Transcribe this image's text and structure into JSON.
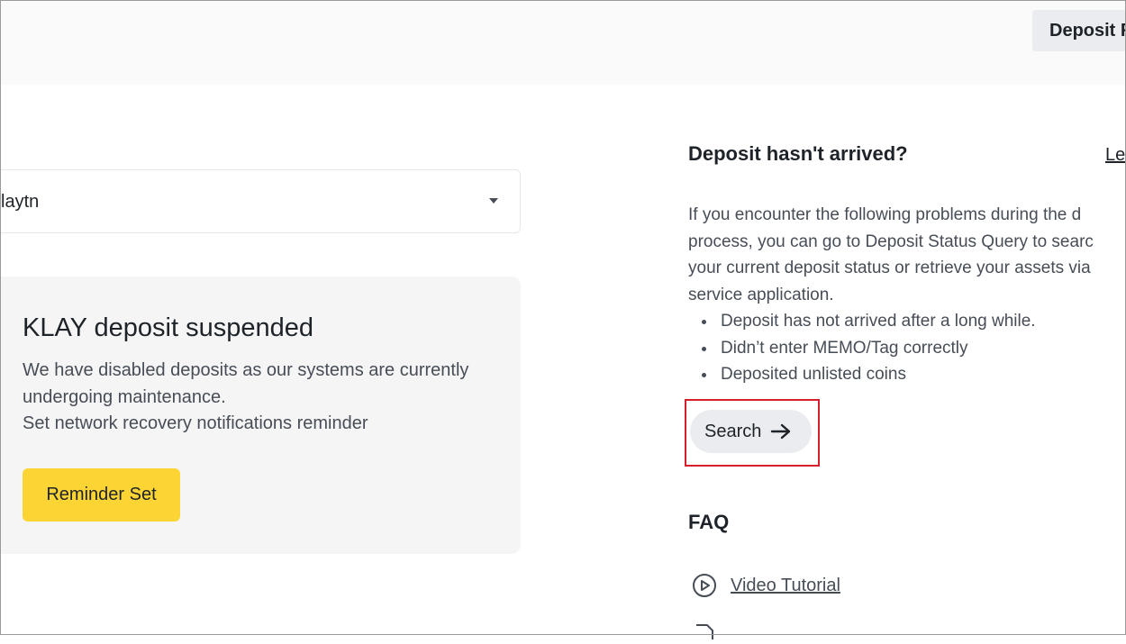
{
  "header": {
    "deposit_history_label": "Deposit F"
  },
  "network": {
    "selected": "laytn"
  },
  "notice": {
    "title": "KLAY deposit suspended",
    "line1": "We have disabled deposits as our systems are currently",
    "line2": "undergoing maintenance.",
    "line3": "Set network recovery notifications reminder",
    "reminder_button": "Reminder Set"
  },
  "help": {
    "title": "Deposit hasn't arrived?",
    "learn_link": "Le",
    "text_lines": [
      "If you encounter the following problems during the d",
      "process, you can go to Deposit Status Query to searc",
      "your current deposit status or retrieve your assets via",
      "service application."
    ],
    "bullets": [
      "Deposit has not arrived after a long while.",
      "Didn’t enter MEMO/Tag correctly",
      "Deposited unlisted coins"
    ],
    "search_button": "Search"
  },
  "faq": {
    "title": "FAQ",
    "items": [
      {
        "label": "Video Tutorial",
        "icon": "play-circle-icon"
      }
    ]
  },
  "colors": {
    "accent_yellow": "#fcd535",
    "highlight_red": "#d81e2a",
    "button_gray": "#eaecef",
    "panel_gray": "#f5f5f5"
  }
}
